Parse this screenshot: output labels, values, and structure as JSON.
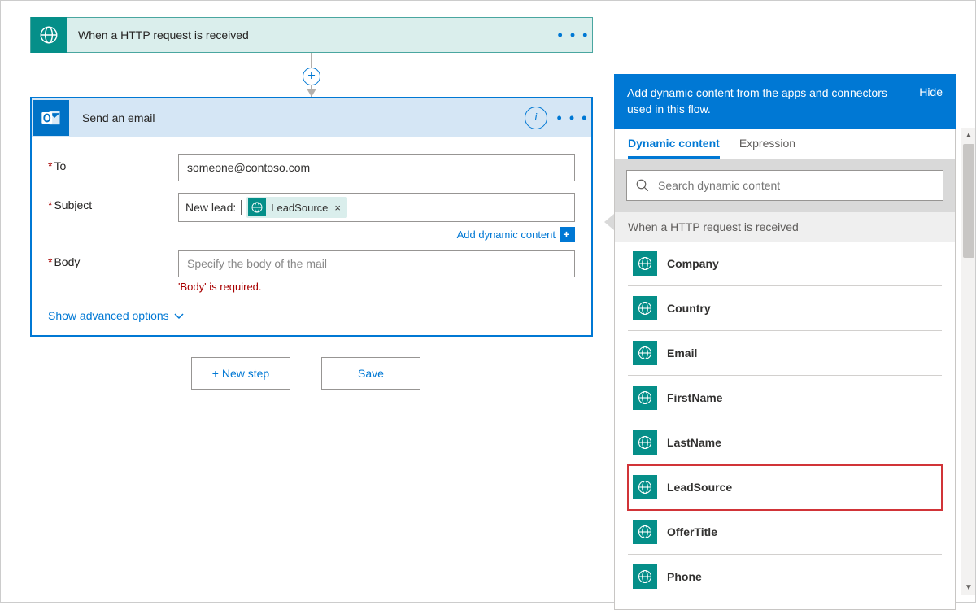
{
  "trigger": {
    "title": "When a HTTP request is received"
  },
  "action": {
    "title": "Send an email",
    "to_label": "To",
    "to_value": "someone@contoso.com",
    "subject_label": "Subject",
    "subject_prefix": "New lead:",
    "subject_token": "LeadSource",
    "add_dynamic_label": "Add dynamic content",
    "body_label": "Body",
    "body_placeholder": "Specify the body of the mail",
    "body_error": "'Body' is required.",
    "advanced_label": "Show advanced options"
  },
  "footer": {
    "new_step": "+ New step",
    "save": "Save"
  },
  "dyn": {
    "header": "Add dynamic content from the apps and connectors used in this flow.",
    "hide": "Hide",
    "tab_dynamic": "Dynamic content",
    "tab_expression": "Expression",
    "search_placeholder": "Search dynamic content",
    "section": "When a HTTP request is received",
    "items": [
      "Company",
      "Country",
      "Email",
      "FirstName",
      "LastName",
      "LeadSource",
      "OfferTitle",
      "Phone"
    ],
    "highlight_index": 5
  }
}
